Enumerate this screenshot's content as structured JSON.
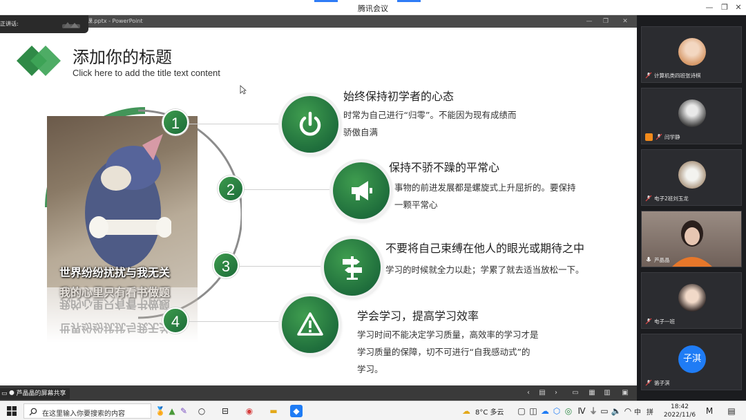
{
  "window": {
    "title": "腾讯会议",
    "controls": {
      "minimize": "—",
      "restore": "❐",
      "close": "✕"
    }
  },
  "speaking": {
    "label": "正讲话:"
  },
  "ppt_window": {
    "title": "…课.pptx - PowerPoint"
  },
  "slide": {
    "title": "添加你的标题",
    "subtitle": "Click here to add the title text content",
    "meme_caption_1": "世界纷纷扰扰与我无关",
    "meme_caption_2": "我的心里只有看书做题",
    "items": [
      {
        "num": "1",
        "heading": "始终保持初学者的心态",
        "body_1": "时常为自己进行“归零”。不能因为现有成绩而",
        "body_2": "骄傲自满",
        "icon": "power-icon"
      },
      {
        "num": "2",
        "heading": "保持不骄不躁的平常心",
        "body_1": "事物的前进发展都是螺旋式上升屈折的。要保持",
        "body_2": "一颗平常心",
        "icon": "megaphone-icon"
      },
      {
        "num": "3",
        "heading": "不要将自己束缚在他人的眼光或期待之中",
        "body_1": "学习的时候就全力以赴；学累了就去适当放松一下。",
        "body_2": "",
        "icon": "signpost-icon"
      },
      {
        "num": "4",
        "heading": "学会学习，提高学习效率",
        "body_1": "学习时间不能决定学习质量，高效率的学习才是",
        "body_2": "学习质量的保障，切不可进行“自我感动式”的",
        "body_3": "学习。",
        "icon": "warning-icon"
      }
    ]
  },
  "share_label": "芦晶晶的屏幕共享",
  "participants": [
    {
      "name": "计算机类四班张诗棋",
      "kind": "avatar"
    },
    {
      "name": "闫学静",
      "kind": "avatar"
    },
    {
      "name": "电子2班刘玉龙",
      "kind": "avatar"
    },
    {
      "name": "芦晶晶",
      "kind": "video"
    },
    {
      "name": "电子一班",
      "kind": "avatar"
    },
    {
      "name": "骆子淇",
      "kind": "initials",
      "initials": "子淇"
    }
  ],
  "taskbar": {
    "search_placeholder": "在这里输入你要搜索的内容",
    "weather": "8°C  多云",
    "ime": "中",
    "ime2": "拼",
    "time": "18:42",
    "date": "2022/11/6"
  },
  "colors": {
    "accent_green": "#2b7d44",
    "meeting_blue": "#1f7cf5",
    "sidebar_bg": "#1b1c1f"
  }
}
